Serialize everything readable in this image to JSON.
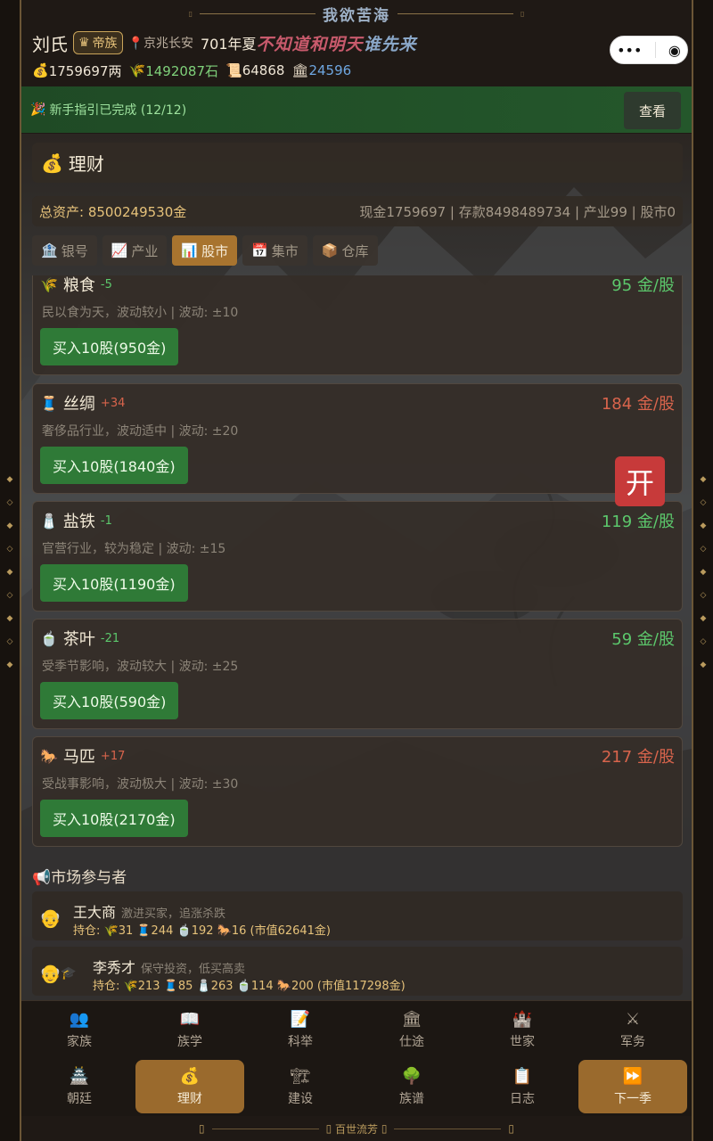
{
  "app": {
    "title": "我欲苦海",
    "footer": "百世流芳"
  },
  "header": {
    "surname": "刘氏",
    "rank_badge": "帝族",
    "location": "京兆长安",
    "date": "701年夏",
    "slogan_red": "不知道和明天",
    "slogan_blue": "谁先来",
    "resources": [
      {
        "icon": "money-bag-icon",
        "glyph": "💰",
        "value": "1759697两",
        "color": "#efe6d6"
      },
      {
        "icon": "grain-icon",
        "glyph": "🌾",
        "value": "1492087石",
        "color": "#7fd07a"
      },
      {
        "icon": "scroll-icon",
        "glyph": "📜",
        "value": "64868",
        "color": "#efe6d6"
      },
      {
        "icon": "bank-icon",
        "glyph": "🏛",
        "value": "24596",
        "color": "#6ea6e0"
      }
    ]
  },
  "capsule": {
    "more": "•••",
    "close": "◉"
  },
  "guide": {
    "text": "新手指引已完成 (12/12)",
    "button": "查看"
  },
  "section": {
    "title": "理财"
  },
  "assets": {
    "total": "总资产: 8500249530金",
    "breakdown": "现金1759697 | 存款8498489734 | 产业99 | 股市0"
  },
  "tabs": [
    {
      "label": "银号",
      "glyph": "🏦",
      "icon": "bank-icon",
      "active": false
    },
    {
      "label": "产业",
      "glyph": "📈",
      "icon": "chart-icon",
      "active": false
    },
    {
      "label": "股市",
      "glyph": "📊",
      "icon": "bar-chart-icon",
      "active": true
    },
    {
      "label": "集市",
      "glyph": "📅",
      "icon": "calendar-icon",
      "active": false
    },
    {
      "label": "仓库",
      "glyph": "📦",
      "icon": "box-icon",
      "active": false
    }
  ],
  "stocks": [
    {
      "name": "粮食",
      "glyph": "🌾",
      "icon": "grain-icon",
      "change": "-5",
      "dir": "down",
      "price": "95 金/股",
      "desc": "民以食为天，波动较小 | 波动: ±10",
      "buy": "买入10股(950金)"
    },
    {
      "name": "丝绸",
      "glyph": "🧵",
      "icon": "silk-icon",
      "change": "+34",
      "dir": "up",
      "price": "184 金/股",
      "desc": "奢侈品行业，波动适中 | 波动: ±20",
      "buy": "买入10股(1840金)"
    },
    {
      "name": "盐铁",
      "glyph": "🧂",
      "icon": "salt-icon",
      "change": "-1",
      "dir": "down",
      "price": "119 金/股",
      "desc": "官营行业，较为稳定 | 波动: ±15",
      "buy": "买入10股(1190金)"
    },
    {
      "name": "茶叶",
      "glyph": "🍵",
      "icon": "tea-icon",
      "change": "-21",
      "dir": "down",
      "price": "59 金/股",
      "desc": "受季节影响，波动较大 | 波动: ±25",
      "buy": "买入10股(590金)"
    },
    {
      "name": "马匹",
      "glyph": "🐎",
      "icon": "horse-icon",
      "change": "+17",
      "dir": "up",
      "price": "217 金/股",
      "desc": "受战事影响，波动极大 | 波动: ±30",
      "buy": "买入10股(2170金)"
    }
  ],
  "market": {
    "title": "市场参与者",
    "players": [
      {
        "name": "王大商",
        "desc": "激进买家，追涨杀跌",
        "holdings": "持仓: 🌾31 🧵244 🍵192 🐎16 (市值62641金)"
      },
      {
        "name": "李秀才",
        "desc": "保守投资，低买高卖",
        "holdings": "持仓: 🌾213 🧵85 🧂263 🍵114 🐎200 (市值117298金)"
      }
    ]
  },
  "floating": {
    "open": "开"
  },
  "nav": [
    {
      "label": "家族",
      "glyph": "👥",
      "icon": "family-icon",
      "active": false
    },
    {
      "label": "族学",
      "glyph": "📖",
      "icon": "book-icon",
      "active": false
    },
    {
      "label": "科举",
      "glyph": "📝",
      "icon": "exam-icon",
      "active": false
    },
    {
      "label": "仕途",
      "glyph": "🏛",
      "icon": "career-icon",
      "active": false
    },
    {
      "label": "世家",
      "glyph": "🏰",
      "icon": "clan-icon",
      "active": false
    },
    {
      "label": "军务",
      "glyph": "⚔",
      "icon": "swords-icon",
      "active": false
    },
    {
      "label": "朝廷",
      "glyph": "🏯",
      "icon": "court-icon",
      "active": false
    },
    {
      "label": "理财",
      "glyph": "💰",
      "icon": "money-bag-icon",
      "active": true
    },
    {
      "label": "建设",
      "glyph": "🏗",
      "icon": "crane-icon",
      "active": false
    },
    {
      "label": "族谱",
      "glyph": "🌳",
      "icon": "tree-icon",
      "active": false
    },
    {
      "label": "日志",
      "glyph": "📋",
      "icon": "log-icon",
      "active": false
    },
    {
      "label": "下一季",
      "glyph": "⏩",
      "icon": "fast-forward-icon",
      "active": true
    }
  ]
}
